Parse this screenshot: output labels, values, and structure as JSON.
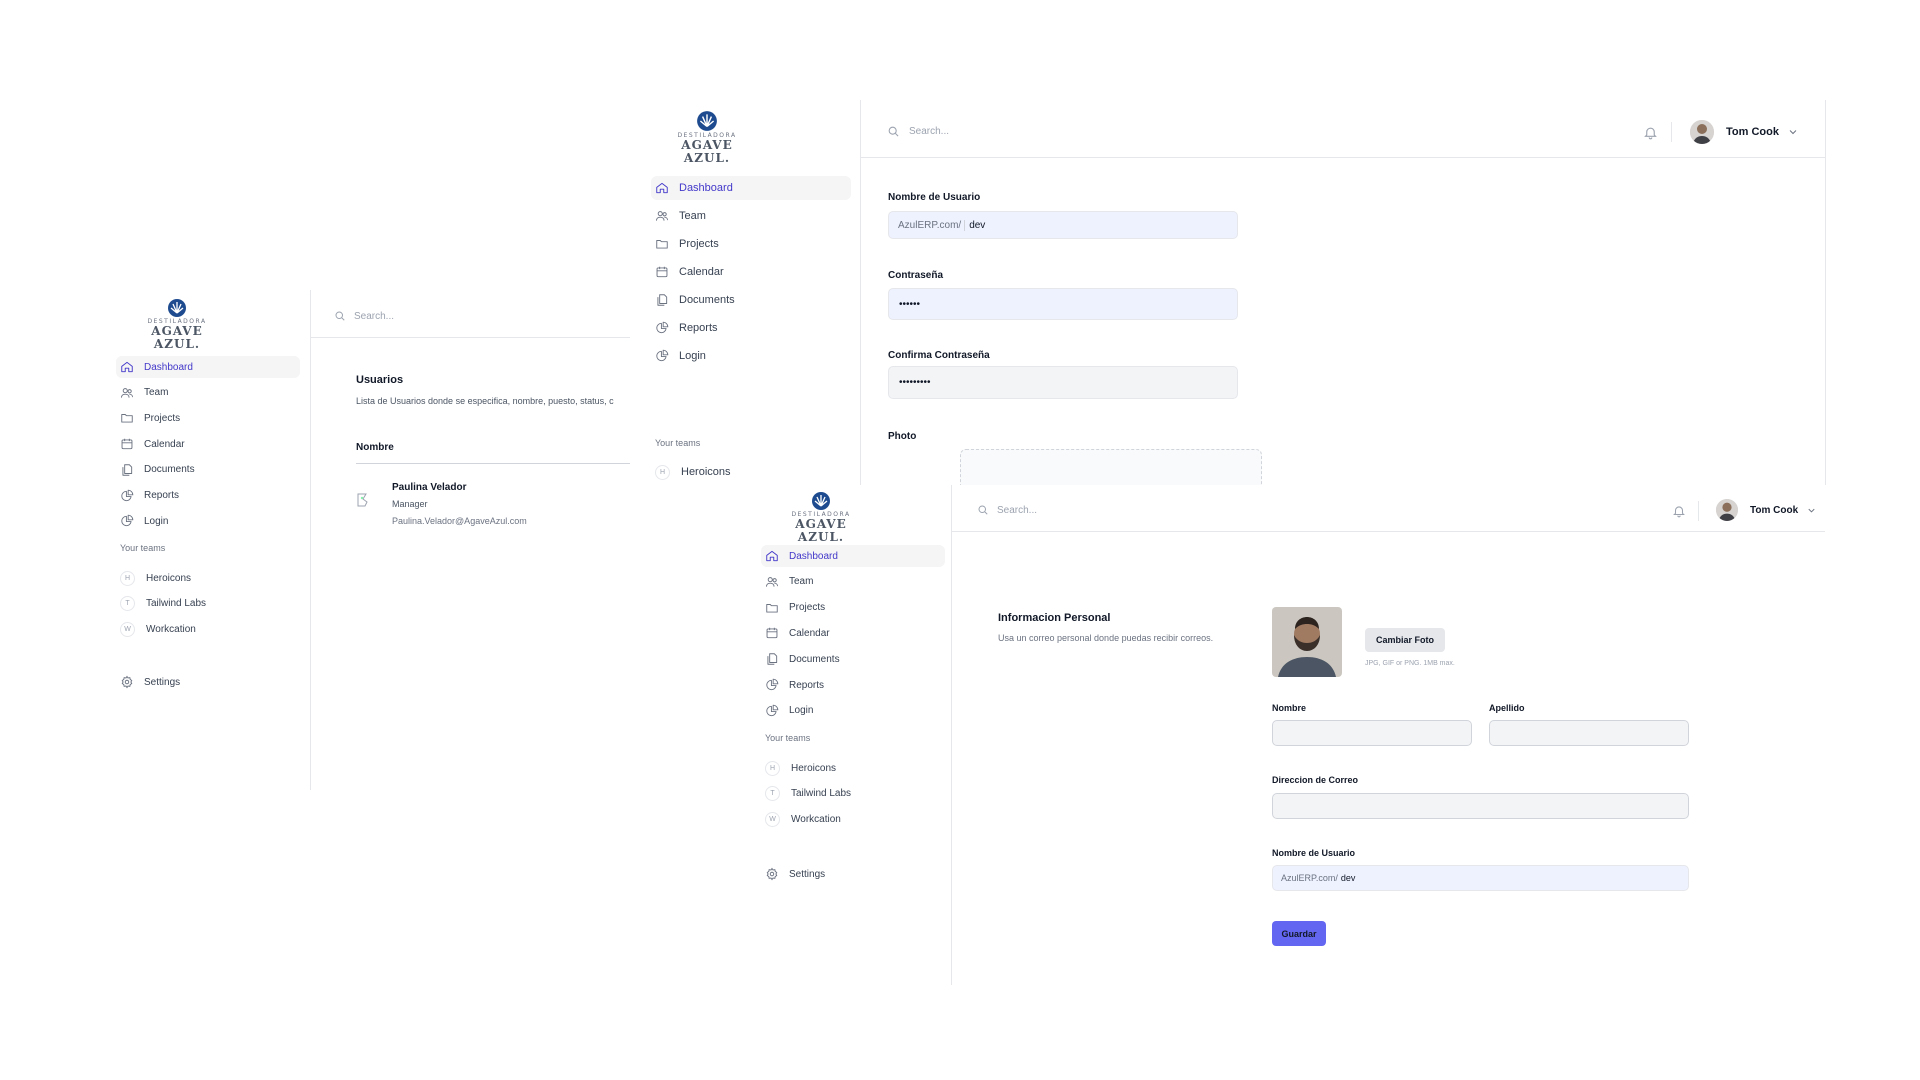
{
  "brand": {
    "line1": "DESTILADORA",
    "line2": "AGAVE AZUL."
  },
  "nav": [
    "Dashboard",
    "Team",
    "Projects",
    "Calendar",
    "Documents",
    "Reports",
    "Login"
  ],
  "teams_label": "Your teams",
  "teams": [
    {
      "letter": "H",
      "name": "Heroicons"
    },
    {
      "letter": "T",
      "name": "Tailwind Labs"
    },
    {
      "letter": "W",
      "name": "Workcation"
    }
  ],
  "settings_label": "Settings",
  "search_placeholder": "Search...",
  "user_name": "Tom Cook",
  "users_page": {
    "title": "Usuarios",
    "description": "Lista de Usuarios donde se especifica, nombre, puesto, status, c",
    "column_header": "Nombre",
    "row": {
      "name": "Paulina Velador",
      "role": "Manager",
      "email": "Paulina.Velador@AgaveAzul.com"
    }
  },
  "account_form": {
    "username_label": "Nombre de Usuario",
    "username_prefix": "AzulERP.com/",
    "username_value": "dev",
    "password_label": "Contraseña",
    "password_value": "••••••",
    "confirm_label": "Confirma Contraseña",
    "confirm_value": "•••••••••",
    "photo_label": "Photo"
  },
  "profile_form": {
    "section_title": "Informacion Personal",
    "section_desc": "Usa un correo personal donde puedas recibir correos.",
    "change_photo": "Cambiar Foto",
    "photo_hint": "JPG, GIF or PNG. 1MB max.",
    "first_name_label": "Nombre",
    "last_name_label": "Apellido",
    "email_label": "Direccion de Correo",
    "username_label": "Nombre de Usuario",
    "username_prefix": "AzulERP.com/",
    "username_value": "dev",
    "save": "Guardar"
  },
  "colors": {
    "accent": "#4338ca",
    "button": "#6366f1"
  }
}
